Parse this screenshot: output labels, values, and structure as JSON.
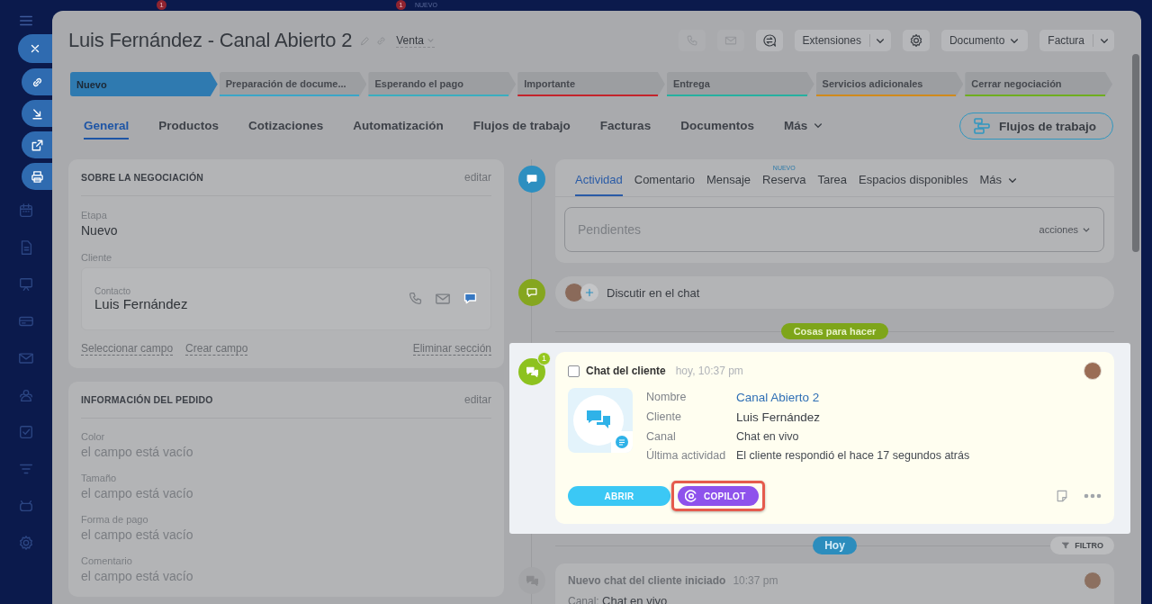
{
  "background": {
    "badges": [
      "1",
      "1"
    ],
    "label": "NUEVO"
  },
  "window": {
    "title": "Luis Fernández - Canal Abierto 2",
    "category": "Venta"
  },
  "toolbar": {
    "extensions": "Extensiones",
    "document": "Documento",
    "invoice": "Factura"
  },
  "stages": [
    {
      "label": "Nuevo",
      "selected": true,
      "color": "#2f7ab0"
    },
    {
      "label": "Preparación de docume...",
      "selected": false,
      "color": "#3aa6c8"
    },
    {
      "label": "Esperando el pago",
      "selected": false,
      "color": "#3aaec0"
    },
    {
      "label": "Importante",
      "selected": false,
      "color": "#c4232b"
    },
    {
      "label": "Entrega",
      "selected": false,
      "color": "#26b0a0"
    },
    {
      "label": "Servicios adicionales",
      "selected": false,
      "color": "#d08a1c"
    },
    {
      "label": "Cerrar negociación",
      "selected": false,
      "color": "#6fae1e"
    }
  ],
  "tabs": [
    {
      "label": "General",
      "selected": true
    },
    {
      "label": "Productos",
      "selected": false
    },
    {
      "label": "Cotizaciones",
      "selected": false
    },
    {
      "label": "Automatización",
      "selected": false
    },
    {
      "label": "Flujos de trabajo",
      "selected": false
    },
    {
      "label": "Facturas",
      "selected": false
    },
    {
      "label": "Documentos",
      "selected": false
    }
  ],
  "tabs_more": "Más",
  "workflow_button": "Flujos de trabajo",
  "sections": [
    {
      "title": "SOBRE LA NEGOCIACIÓN",
      "edit": "editar",
      "fields": [
        {
          "kind": "value",
          "label": "Etapa",
          "value": "Nuevo"
        },
        {
          "kind": "contact",
          "label": "Cliente",
          "contact_label": "Contacto",
          "value": "Luis Fernández"
        }
      ],
      "links": [
        "Seleccionar campo",
        "Crear campo"
      ],
      "remove": "Eliminar sección"
    },
    {
      "title": "INFORMACIÓN DEL PEDIDO",
      "edit": "editar",
      "fields": [
        {
          "kind": "empty",
          "label": "Color",
          "value": "el campo está vacío"
        },
        {
          "kind": "empty",
          "label": "Tamaño",
          "value": "el campo está vacío"
        },
        {
          "kind": "empty",
          "label": "Forma de pago",
          "value": "el campo está vacío"
        },
        {
          "kind": "empty",
          "label": "Comentario",
          "value": "el campo está vacío"
        }
      ]
    }
  ],
  "activity": {
    "tabs": [
      {
        "label": "Actividad",
        "selected": true
      },
      {
        "label": "Comentario",
        "selected": false
      },
      {
        "label": "Mensaje",
        "selected": false
      },
      {
        "label": "Reserva",
        "selected": false,
        "badge": "NUEVO"
      },
      {
        "label": "Tarea",
        "selected": false
      },
      {
        "label": "Espacios disponibles",
        "selected": false
      }
    ],
    "more": "Más",
    "placeholder": "Pendientes",
    "actions": "acciones"
  },
  "discuss": "Discutir en el chat",
  "todo_label": "Cosas para hacer",
  "chat": {
    "counter": "1",
    "checked": false,
    "title": "Chat del cliente",
    "time": "hoy, 10:37 pm",
    "rows": [
      {
        "kind": "link",
        "label": "Nombre",
        "value": "Canal Abierto 2"
      },
      {
        "kind": "text",
        "label": "Cliente",
        "value": "Luis Fernández"
      },
      {
        "kind": "text",
        "label": "Canal",
        "value": "Chat en vivo"
      },
      {
        "kind": "text",
        "label": "Última actividad",
        "value": "El cliente respondió el hace 17 segundos atrás"
      }
    ],
    "open": "ABRIR",
    "copilot": "COPILOT"
  },
  "today": "Hoy",
  "filter": "FILTRO",
  "history": {
    "title": "Nuevo chat del cliente iniciado",
    "time": "10:37 pm",
    "channel_label": "Canal:",
    "channel": "Chat en vivo"
  }
}
